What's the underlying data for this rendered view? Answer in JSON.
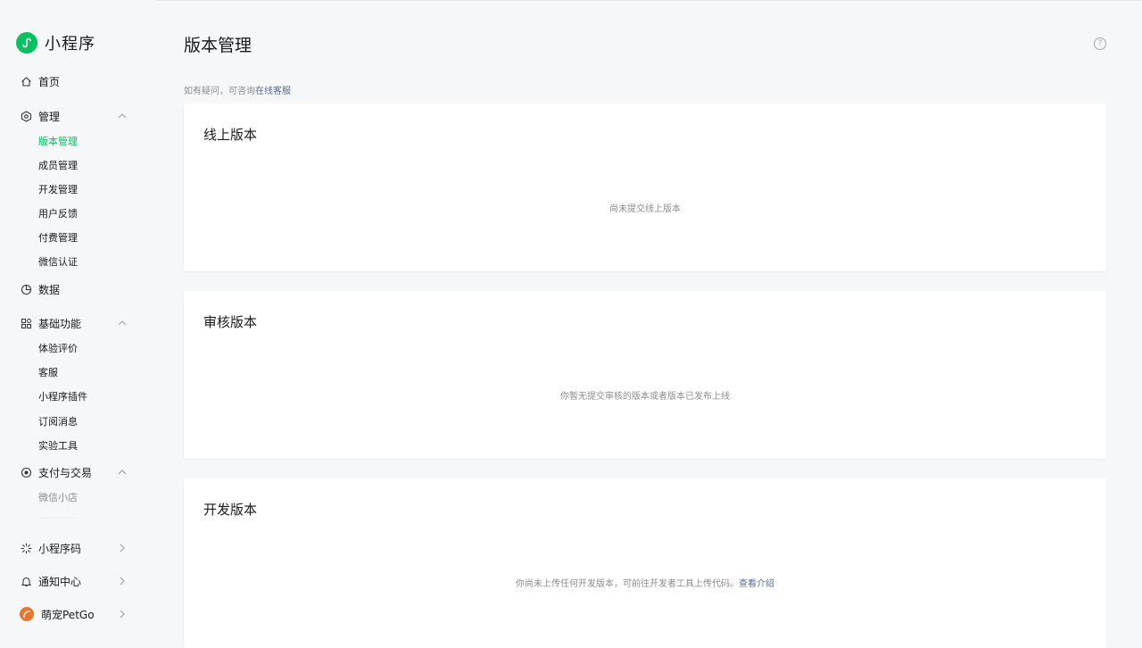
{
  "brand": {
    "title": "小程序",
    "logo_icon": "miniprogram-logo-icon",
    "color": "#07c160"
  },
  "sidebar": {
    "home": {
      "label": "首页",
      "icon": "home-icon"
    },
    "manage": {
      "label": "管理",
      "icon": "hexagon-settings-icon",
      "items": [
        "版本管理",
        "成员管理",
        "开发管理",
        "用户反馈",
        "付费管理",
        "微信认证"
      ]
    },
    "data": {
      "label": "数据",
      "icon": "pie-chart-icon"
    },
    "basic": {
      "label": "基础功能",
      "icon": "grid-apps-icon",
      "items": [
        "体验评价",
        "客服",
        "小程序插件",
        "订阅消息",
        "实验工具"
      ]
    },
    "pay": {
      "label": "支付与交易",
      "icon": "currency-icon",
      "items": [
        "微信小店"
      ]
    },
    "qrcode": {
      "label": "小程序码",
      "icon": "loading-spinner-icon"
    },
    "notify": {
      "label": "通知中心",
      "icon": "bell-icon"
    },
    "account": {
      "label": "萌宠PetGo",
      "icon": "avatar"
    }
  },
  "main": {
    "title": "版本管理",
    "hint_prefix": "如有疑问，可咨询",
    "hint_link": "在线客服",
    "cards": [
      {
        "title": "线上版本",
        "empty": "尚未提交线上版本"
      },
      {
        "title": "审核版本",
        "empty": "你暂无提交审核的版本或者版本已发布上线"
      },
      {
        "title": "开发版本",
        "empty": "你尚未上传任何开发版本，可前往开发者工具上传代码。",
        "link": "查看介绍"
      }
    ]
  },
  "colors": {
    "accent": "#07c160",
    "link": "#576b95",
    "muted": "#8c8c8c"
  }
}
